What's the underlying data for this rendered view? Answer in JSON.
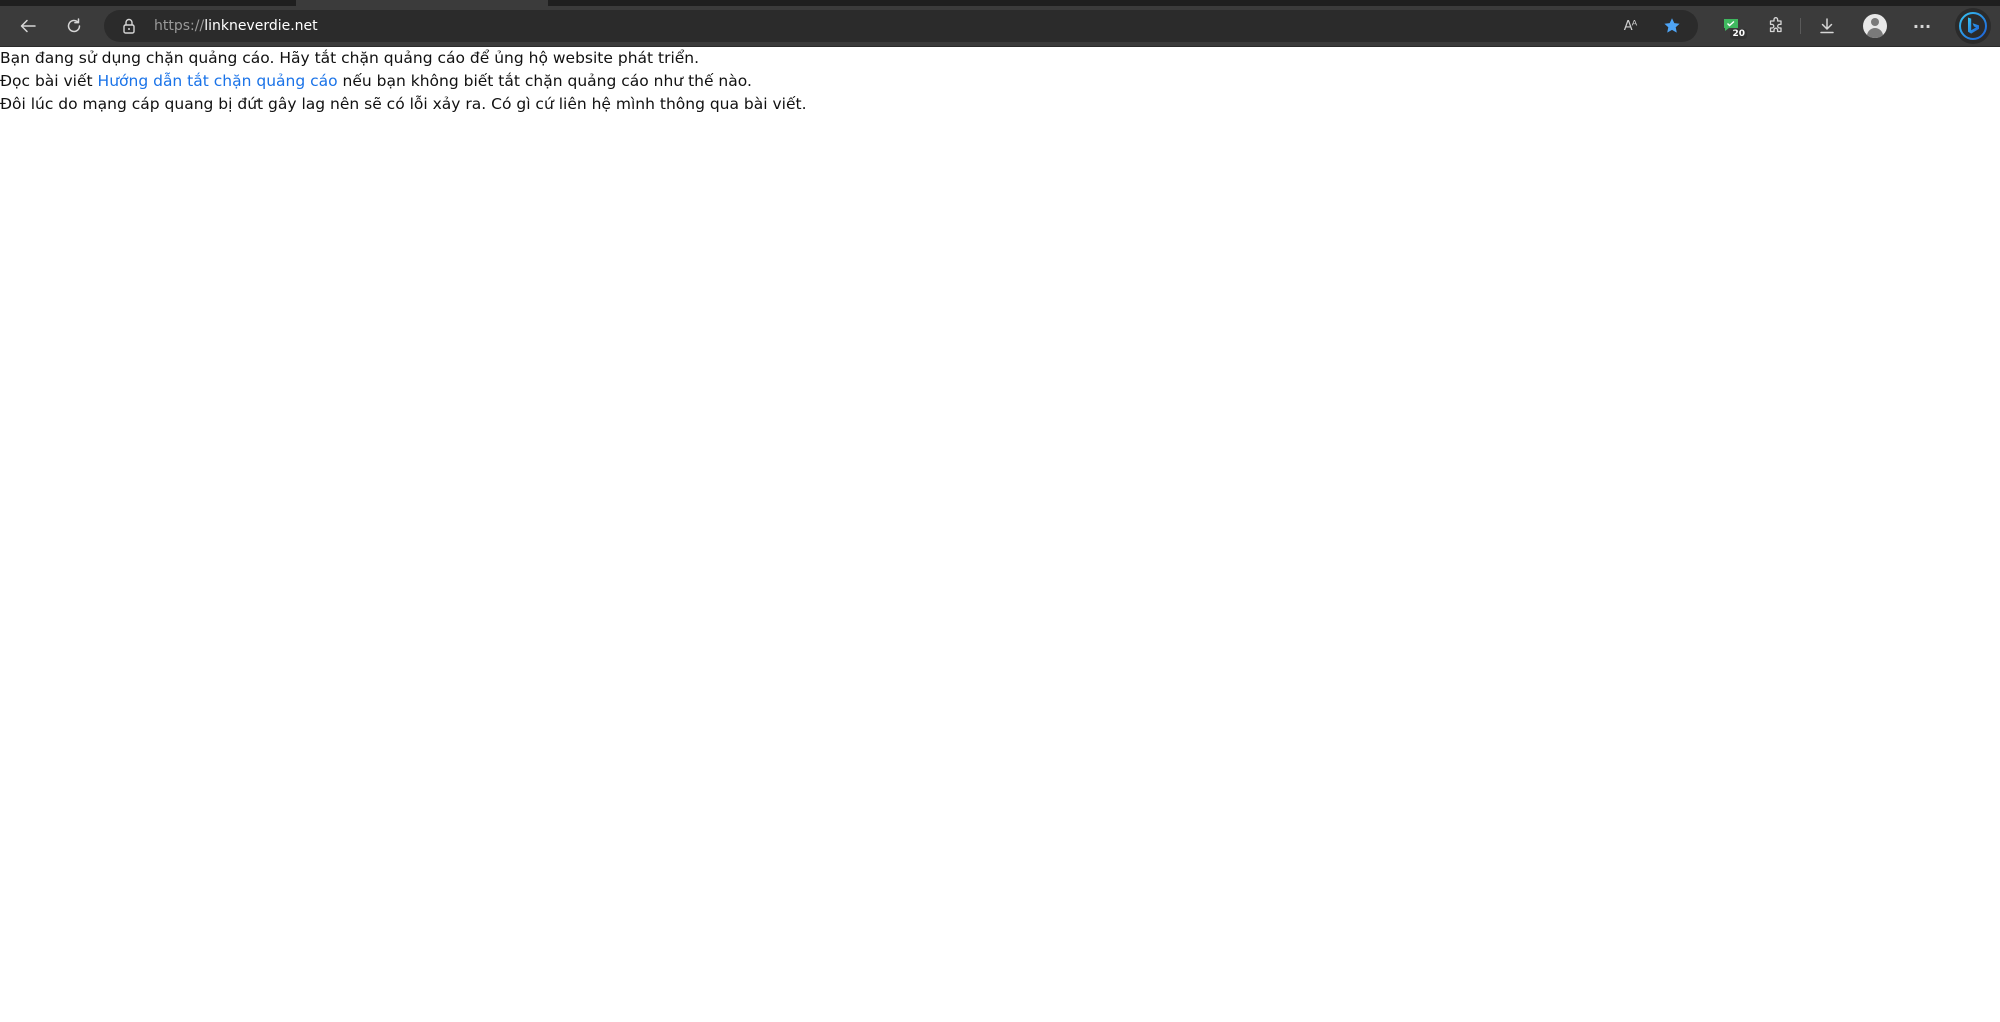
{
  "browser": {
    "url_protocol": "https://",
    "url_host": "linkneverdie.net",
    "extension_badge": "20",
    "read_aloud_glyph": "Aᴬ",
    "more_glyph": "···",
    "favorite_star_color": "#4ea4f5",
    "extension_icon_color": "#3fb85f",
    "icons": [
      "back-icon",
      "refresh-icon",
      "lock-icon",
      "read-aloud-icon",
      "favorite-star-icon",
      "extension-icon",
      "extensions-puzzle-icon",
      "download-icon",
      "profile-avatar-icon",
      "more-icon",
      "bing-icon"
    ]
  },
  "page": {
    "line1": "Bạn đang sử dụng chặn quảng cáo. Hãy tắt chặn quảng cáo để ủng hộ website phát triển.",
    "line2_prefix": "Đọc bài viết ",
    "line2_link": "Hướng dẫn tắt chặn quảng cáo",
    "line2_suffix": " nếu bạn không biết tắt chặn quảng cáo như thế nào.",
    "line3": "Đôi lúc do mạng cáp quang bị đứt gây lag nên sẽ có lỗi xảy ra. Có gì cứ liên hệ mình thông qua bài viết.",
    "link_color": "#1a73e8"
  }
}
